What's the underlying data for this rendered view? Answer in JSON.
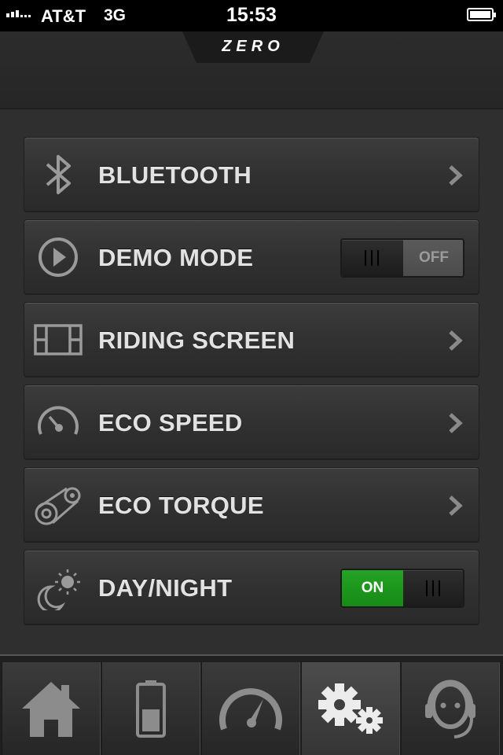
{
  "status_bar": {
    "carrier": "AT&T",
    "network": "3G",
    "time": "15:53"
  },
  "header": {
    "logo_text": "ZERO"
  },
  "settings": [
    {
      "label": "BLUETOOTH",
      "icon": "bluetooth-icon",
      "control": "chevron"
    },
    {
      "label": "DEMO MODE",
      "icon": "play-icon",
      "control": "toggle",
      "toggle_text": "OFF",
      "toggle_on": false
    },
    {
      "label": "RIDING SCREEN",
      "icon": "film-strip-icon",
      "control": "chevron"
    },
    {
      "label": "ECO SPEED",
      "icon": "speedometer-icon",
      "control": "chevron"
    },
    {
      "label": "ECO TORQUE",
      "icon": "belt-drive-icon",
      "control": "chevron"
    },
    {
      "label": "DAY/NIGHT",
      "icon": "sun-moon-icon",
      "control": "toggle",
      "toggle_text": "ON",
      "toggle_on": true
    }
  ],
  "tabs": [
    {
      "icon": "home-icon",
      "active": false
    },
    {
      "icon": "battery-icon",
      "active": false
    },
    {
      "icon": "gauge-icon",
      "active": false
    },
    {
      "icon": "gears-icon",
      "active": true
    },
    {
      "icon": "support-headset-icon",
      "active": false
    }
  ],
  "colors": {
    "toggle_on": "#1c991c",
    "background": "#2f2f2f",
    "label": "#e2e2e2"
  }
}
